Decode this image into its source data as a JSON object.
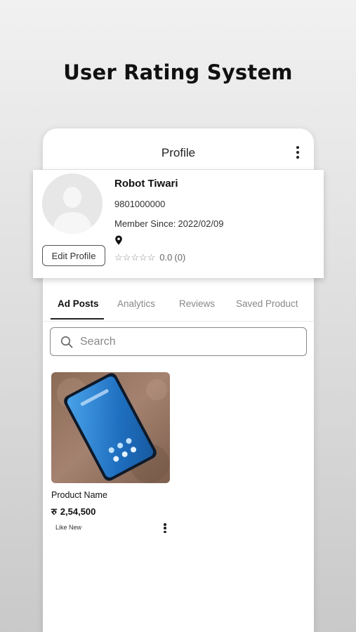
{
  "headline": "User Rating System",
  "appbar": {
    "title": "Profile",
    "menu_icon": "more-vertical-icon"
  },
  "profile": {
    "name": "Robot Tiwari",
    "phone": "9801000000",
    "member_label": "Member Since:",
    "member_date": "2022/02/09",
    "location": "",
    "location_icon": "map-pin-icon",
    "edit_button": "Edit Profile",
    "rating": {
      "stars_filled": 0,
      "stars_total": 5,
      "score": "0.0",
      "count": "(0)"
    },
    "avatar_icon": "user-placeholder-icon"
  },
  "tabs": [
    {
      "label": "Ad Posts",
      "active": true
    },
    {
      "label": "Analytics",
      "active": false
    },
    {
      "label": "Reviews",
      "active": false
    },
    {
      "label": "Saved Product",
      "active": false
    }
  ],
  "search": {
    "placeholder": "Search",
    "value": "",
    "icon": "search-icon"
  },
  "products": [
    {
      "name": "Product Name",
      "currency": "रु",
      "price": "2,54,500",
      "condition": "Like New",
      "image": "smartphone-photo",
      "menu_icon": "more-vertical-icon"
    }
  ],
  "colors": {
    "active_tab": "#222222",
    "inactive_tab": "#888888",
    "card_bg": "#ffffff"
  }
}
